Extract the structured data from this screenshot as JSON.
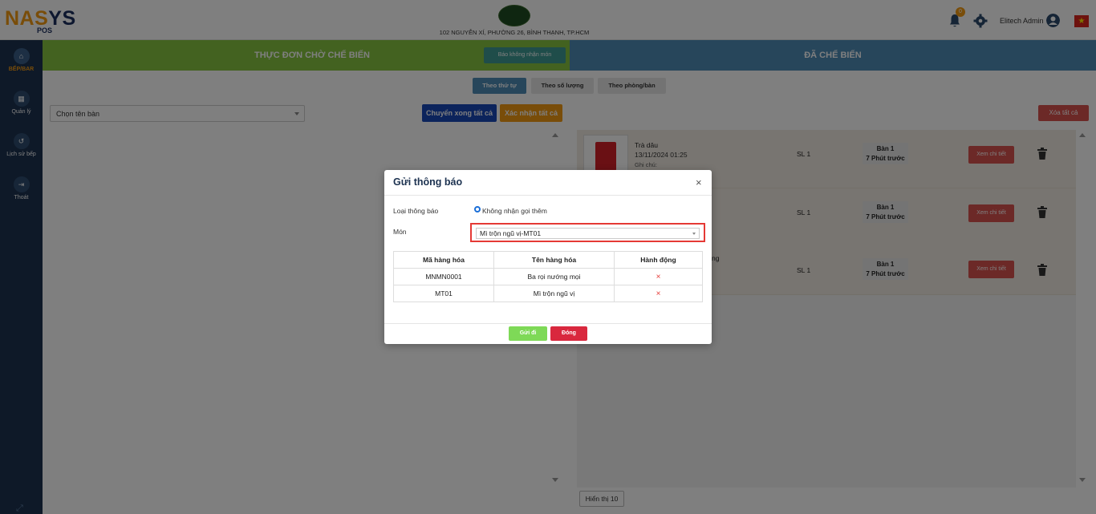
{
  "header": {
    "logo_main_a": "NAS",
    "logo_main_b": "YS",
    "logo_sub": "POS",
    "address": "102 NGUYỄN XÍ, PHƯỜNG 26, BÌNH THẠNH, TP.HCM",
    "notification_count": "0",
    "user_name": "Elitech Admin",
    "icons": {
      "bell": "bell-icon",
      "settings": "gear-icon",
      "user": "user-circle-icon",
      "flag": "vietnam-flag-icon"
    }
  },
  "sidebar": {
    "items": [
      {
        "label": "BẾP/BAR",
        "icon": "home-icon",
        "active": true
      },
      {
        "label": "Quản lý",
        "icon": "grid-icon",
        "active": false
      },
      {
        "label": "Lịch sử bếp",
        "icon": "history-icon",
        "active": false
      },
      {
        "label": "Thoát",
        "icon": "logout-icon",
        "active": false
      }
    ],
    "expand_icon": "expand-icon"
  },
  "left_panel": {
    "title": "THỰC ĐƠN CHỜ CHẾ BIẾN",
    "report_button": "Báo không nhận món",
    "tabs": [
      "Theo thứ tự",
      "Theo số lượng",
      "Theo phòng/bàn"
    ],
    "table_select_placeholder": "Chọn tên bàn",
    "btn_transfer_all": "Chuyển xong tất cả",
    "btn_confirm_all": "Xác nhận tất cả"
  },
  "right_panel": {
    "title": "ĐÃ CHẾ BIẾN",
    "btn_delete_all": "Xóa tất cả",
    "orders": [
      {
        "name": "Trà dâu",
        "time": "13/11/2024 01:25",
        "note": "Ghi chú:",
        "qty": "SL 1",
        "table": "Bàn 1",
        "ago": "7 Phút trước",
        "detail": "Xem chi tiết"
      },
      {
        "name": "",
        "time": "",
        "note": "",
        "qty": "SL 1",
        "table": "Bàn 1",
        "ago": "7 Phút trước",
        "detail": "Xem chi tiết"
      },
      {
        "name": "nướng",
        "time": "",
        "note": "",
        "qty": "SL 1",
        "table": "Bàn 1",
        "ago": "7 Phút trước",
        "detail": "Xem chi tiết"
      }
    ],
    "page_size_label": "Hiển thị 10"
  },
  "modal": {
    "title": "Gửi thông báo",
    "close": "×",
    "notification_type_label": "Loại thông báo",
    "notification_type_value": "Không nhận gọi thêm",
    "item_label": "Món",
    "item_selected": "Mì trộn ngũ vị-MT01",
    "table_headers": [
      "Mã hàng hóa",
      "Tên hàng hóa",
      "Hành động"
    ],
    "table_rows": [
      {
        "code": "MNMN0001",
        "name": "Ba rọi nướng mọi",
        "action": "×"
      },
      {
        "code": "MT01",
        "name": "Mì trộn ngũ vị",
        "action": "×"
      }
    ],
    "btn_send": "Gửi đi",
    "btn_close": "Đóng"
  }
}
